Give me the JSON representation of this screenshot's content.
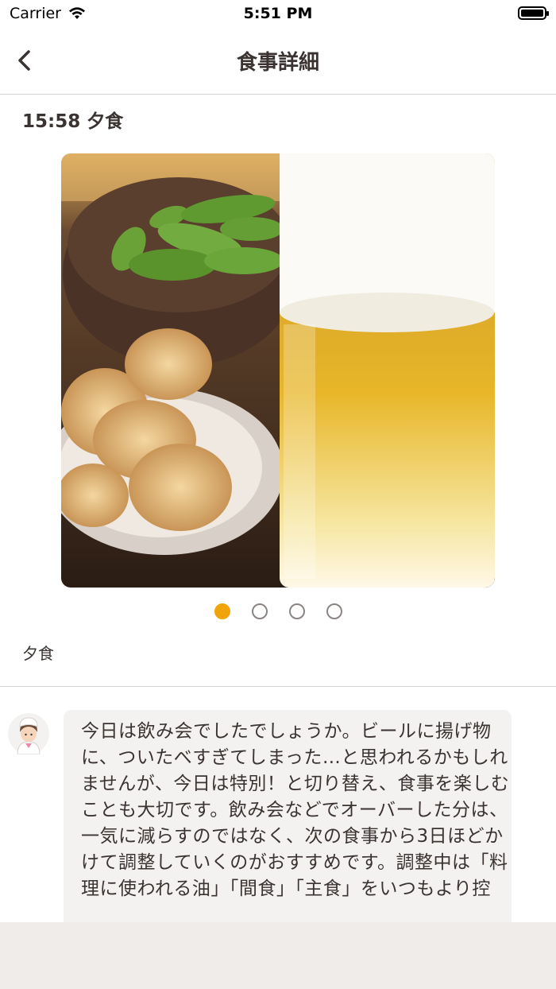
{
  "status_bar": {
    "carrier": "Carrier",
    "time": "5:51 PM"
  },
  "nav": {
    "title": "食事詳細"
  },
  "meal": {
    "time_title": "15:58 夕食",
    "label": "夕食",
    "photo_alt": "beer-and-karaage-photo",
    "page_count": 4,
    "active_page": 1
  },
  "advice": {
    "text": "今日は飲み会でしたでしょうか。ビールに揚げ物に、ついたべすぎてしまった…と思われるかもしれませんが、今日は特別！と切り替え、食事を楽しむことも大切です。飲み会などでオーバーした分は、一気に減らすのではなく、次の食事から3日ほどかけて調整していくのがおすすめです。調整中は「料理に使われる油」「間食」「主食」をいつもより控"
  },
  "colors": {
    "accent": "#f0a30a",
    "text": "#3a3331",
    "bubble": "#f4f2f1",
    "bottom_bar": "#efecea"
  }
}
